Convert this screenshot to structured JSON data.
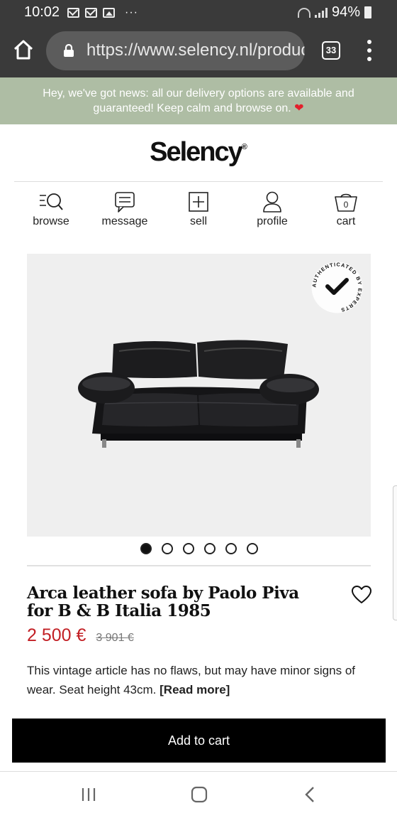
{
  "status_bar": {
    "time": "10:02",
    "battery": "94%",
    "overflow": "···"
  },
  "browser": {
    "url": "https://www.selency.nl/product",
    "tab_count": "33"
  },
  "banner": {
    "text": "Hey, we've got news: all our delivery options are available and guaranteed! Keep calm and browse on.",
    "emoji": "❤"
  },
  "logo": {
    "text": "Selency",
    "mark": "®"
  },
  "nav": {
    "browse": "browse",
    "message": "message",
    "sell": "sell",
    "profile": "profile",
    "cart": "cart",
    "cart_count": "0"
  },
  "gallery": {
    "badge_text": "AUTHENTICATED BY EXPERTS",
    "image_count": 6,
    "active_index": 0
  },
  "product": {
    "title": "Arca leather sofa by Paolo Piva for B & B Italia 1985",
    "price": "2 500 €",
    "old_price": "3 901 €",
    "description": "This vintage article has no flaws, but may have minor signs of wear. Seat height 43cm.",
    "read_more": "[Read more]"
  },
  "cta": {
    "add_to_cart": "Add to cart"
  },
  "colors": {
    "banner_bg": "#aebda4",
    "price": "#c21f24",
    "cta_bg": "#000000",
    "chrome_bg": "#3a3a3a"
  }
}
